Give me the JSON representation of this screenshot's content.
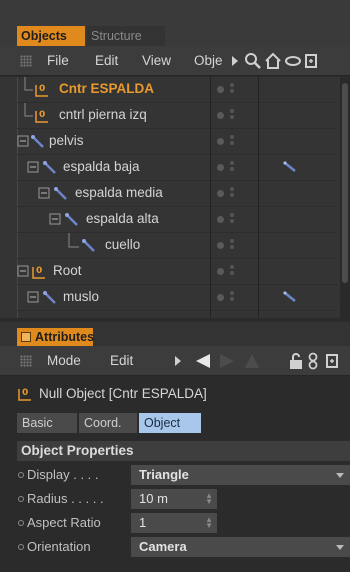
{
  "tabs": {
    "objects": "Objects",
    "structure": "Structure"
  },
  "menu": {
    "file": "File",
    "edit": "Edit",
    "view": "View",
    "objects_truncated": "Obje"
  },
  "tree": {
    "rows": [
      {
        "label": "Cntr ESPALDA",
        "type": "null",
        "selected": true
      },
      {
        "label": "cntrl pierna izq",
        "type": "null",
        "selected": false
      },
      {
        "label": "pelvis",
        "type": "bone",
        "selected": false
      },
      {
        "label": "espalda baja",
        "type": "bone",
        "selected": false
      },
      {
        "label": "espalda media",
        "type": "bone",
        "selected": false
      },
      {
        "label": "espalda alta",
        "type": "bone",
        "selected": false
      },
      {
        "label": "cuello",
        "type": "bone",
        "selected": false
      },
      {
        "label": "Root",
        "type": "null",
        "selected": false
      },
      {
        "label": "muslo",
        "type": "bone",
        "selected": false
      }
    ]
  },
  "attributes": {
    "tab_label": "Attributes",
    "menu": {
      "mode": "Mode",
      "edit": "Edit"
    },
    "object_title": "Null Object [Cntr ESPALDA]",
    "subtabs": [
      "Basic",
      "Coord.",
      "Object"
    ],
    "active_subtab": "Object",
    "section_title": "Object Properties",
    "properties": {
      "display": {
        "label": "Display . . . .",
        "value": "Triangle"
      },
      "radius": {
        "label": "Radius . . . . .",
        "value": "10 m"
      },
      "aspect_ratio": {
        "label": "Aspect Ratio",
        "value": "1"
      },
      "orientation": {
        "label": "Orientation",
        "value": "Camera"
      }
    }
  },
  "colors": {
    "accent": "#e08a1e",
    "selected_text": "#e89a2e",
    "tab_active": "#a9c7ea",
    "bone_icon": "#6d85c9"
  }
}
